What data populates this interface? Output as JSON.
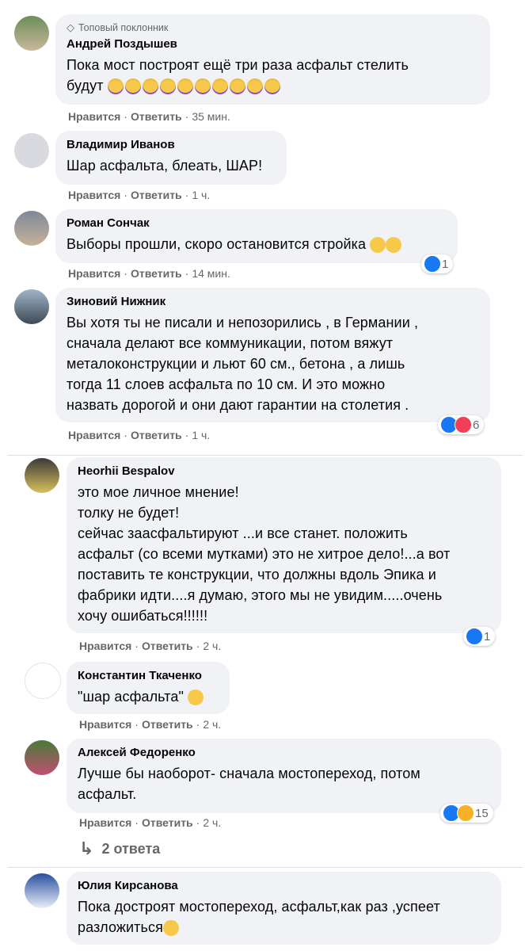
{
  "labels": {
    "like": "Нравится",
    "reply": "Ответить",
    "dot": "·",
    "top_fan": "Топовый поклонник"
  },
  "colors": {
    "bubble": "#f0f2f5",
    "secondary": "#65676b",
    "like": "#1877f2",
    "love": "#f33e58",
    "haha": "#f7b125"
  },
  "comments": [
    {
      "name": "Андрей Поздышев",
      "badge": "Топовый поклонник",
      "text": "Пока мост построят ещё три раза асфальт стелить\nбудут",
      "emoji": "star-struck-icon x10",
      "time": "35 мин."
    },
    {
      "name": "Владимир Иванов",
      "text": "Шар асфальта, блеать, ШАР!",
      "time": "1 ч."
    },
    {
      "name": "Роман Сончак",
      "text": "Выборы прошли, скоро остановится стройка",
      "emoji": "pensive-icon, thinking-icon",
      "time": "14 мин.",
      "reactions": "1"
    },
    {
      "name": "Зиновий Нижник",
      "text": "Вы хотя ты не писали и непозорились , в Германии ,\nсначала делают все коммуникации, потом вяжут\nметалоконструкции и льют 60 см., бетона , а лишь\nтогда 11 слоев асфальта по 10 см. И это можно\nназвать дорогой и они дают гарантии на столетия .",
      "time": "1 ч.",
      "reactions": "6"
    },
    {
      "name": "Heorhii Bespalov",
      "text": "это мое личное мнение!\nтолку не будет!\nсейчас заасфальтируют ...и все станет. положить\nасфальт (со всеми мутками) это не хитрое дело!...а вот\nпоставить те конструкции, что должны вдоль Эпика и\nфабрики идти....я думаю, этого мы не увидим.....очень\nхочу ошибаться!!!!!!",
      "time": "2 ч.",
      "reactions": "1"
    },
    {
      "name": "Константин Ткаченко",
      "text": "\"шар асфальта\"",
      "emoji": "tears-of-joy-icon",
      "time": "2 ч."
    },
    {
      "name": "Алексей Федоренко",
      "text": "Лучше бы наоборот- сначала мостопереход, потом\nасфальт.",
      "time": "2 ч.",
      "reactions": "15"
    },
    {
      "name": "Юлия Кирсанова",
      "text": "Пока достроят мостопереход, асфальт,как раз ,успеет\nразложиться",
      "emoji": "frowning-icon"
    }
  ],
  "replies_link": "2 ответа"
}
